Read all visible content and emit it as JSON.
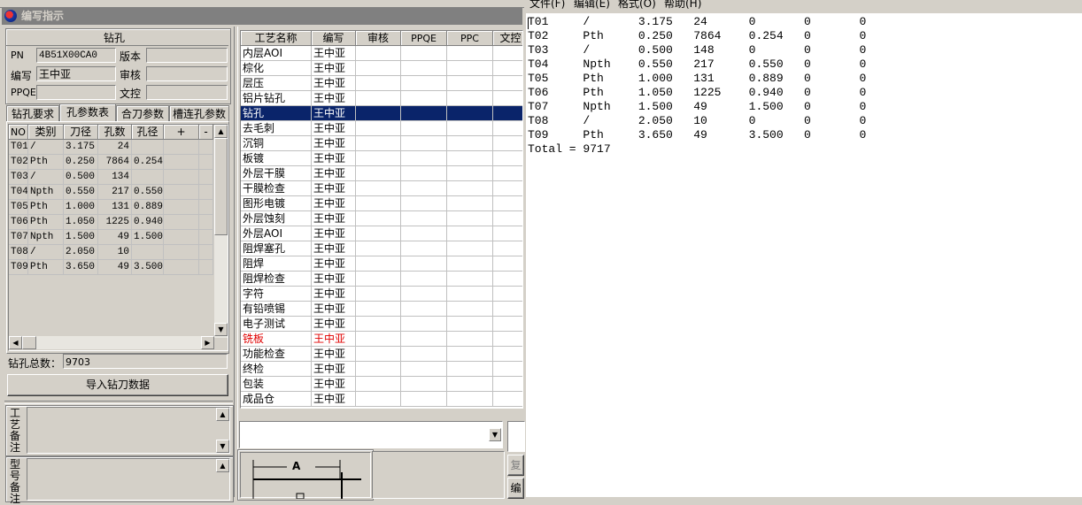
{
  "app": {
    "title": "编写指示"
  },
  "drill": {
    "section_title": "钻孔",
    "pn_label": "PN",
    "pn_value": "4B51X00CA0",
    "version_label": "版本",
    "version_value": "",
    "author_label": "编写",
    "author_value": "王中亚",
    "review_label": "审核",
    "review_value": "",
    "ppqe_label": "PPQE",
    "ppqe_value": "",
    "doc_label": "文控",
    "doc_value": ""
  },
  "tabs": [
    {
      "label": "钻孔要求"
    },
    {
      "label": "孔参数表"
    },
    {
      "label": "合刀参数"
    },
    {
      "label": "槽连孔参数"
    }
  ],
  "hole_table": {
    "headers": [
      "NO",
      "类别",
      "刀径",
      "孔数",
      "孔径",
      "+",
      "-"
    ],
    "rows": [
      [
        "T01",
        "/",
        "3.175",
        "24",
        ""
      ],
      [
        "T02",
        "Pth",
        "0.250",
        "7864",
        "0.254"
      ],
      [
        "T03",
        "/",
        "0.500",
        "134",
        ""
      ],
      [
        "T04",
        "Npth",
        "0.550",
        "217",
        "0.550"
      ],
      [
        "T05",
        "Pth",
        "1.000",
        "131",
        "0.889"
      ],
      [
        "T06",
        "Pth",
        "1.050",
        "1225",
        "0.940"
      ],
      [
        "T07",
        "Npth",
        "1.500",
        "49",
        "1.500"
      ],
      [
        "T08",
        "/",
        "2.050",
        "10",
        ""
      ],
      [
        "T09",
        "Pth",
        "3.650",
        "49",
        "3.500"
      ]
    ]
  },
  "total": {
    "label": "钻孔总数：",
    "value": "9703"
  },
  "import_button": "导入钻刀数据",
  "memo1_label": "工艺备注",
  "memo2_label": "型号备注",
  "process_table": {
    "headers": [
      "工艺名称",
      "编写",
      "审核",
      "PPQE",
      "PPC",
      "文控"
    ],
    "rows": [
      {
        "name": "内层AOI",
        "author": "王中亚",
        "state": "normal"
      },
      {
        "name": "棕化",
        "author": "王中亚",
        "state": "normal"
      },
      {
        "name": "层压",
        "author": "王中亚",
        "state": "normal"
      },
      {
        "name": "铝片钻孔",
        "author": "王中亚",
        "state": "normal"
      },
      {
        "name": "钻孔",
        "author": "王中亚",
        "state": "selected"
      },
      {
        "name": "去毛刺",
        "author": "王中亚",
        "state": "normal"
      },
      {
        "name": "沉铜",
        "author": "王中亚",
        "state": "normal"
      },
      {
        "name": "板镀",
        "author": "王中亚",
        "state": "normal"
      },
      {
        "name": "外层干膜",
        "author": "王中亚",
        "state": "normal"
      },
      {
        "name": "干膜检查",
        "author": "王中亚",
        "state": "normal"
      },
      {
        "name": "图形电镀",
        "author": "王中亚",
        "state": "normal"
      },
      {
        "name": "外层蚀刻",
        "author": "王中亚",
        "state": "normal"
      },
      {
        "name": "外层AOI",
        "author": "王中亚",
        "state": "normal"
      },
      {
        "name": "阻焊塞孔",
        "author": "王中亚",
        "state": "normal"
      },
      {
        "name": "阻焊",
        "author": "王中亚",
        "state": "normal"
      },
      {
        "name": "阻焊检查",
        "author": "王中亚",
        "state": "normal"
      },
      {
        "name": "字符",
        "author": "王中亚",
        "state": "normal"
      },
      {
        "name": "有铅喷锡",
        "author": "王中亚",
        "state": "normal"
      },
      {
        "name": "电子测试",
        "author": "王中亚",
        "state": "normal"
      },
      {
        "name": "铣板",
        "author": "王中亚",
        "state": "red"
      },
      {
        "name": "功能检查",
        "author": "王中亚",
        "state": "normal"
      },
      {
        "name": "终检",
        "author": "王中亚",
        "state": "normal"
      },
      {
        "name": "包装",
        "author": "王中亚",
        "state": "normal"
      },
      {
        "name": "成品仓",
        "author": "王中亚",
        "state": "normal"
      }
    ]
  },
  "diagram_label": "A",
  "side_buttons": [
    "复",
    "编"
  ],
  "notepad": {
    "menu": [
      "文件(F)",
      "编辑(E)",
      "格式(O)",
      "帮助(H)"
    ],
    "lines": [
      "T01     /       3.175   24      0       0       0",
      "T02     Pth     0.250   7864    0.254   0       0",
      "T03     /       0.500   148     0       0       0",
      "T04     Npth    0.550   217     0.550   0       0",
      "T05     Pth     1.000   131     0.889   0       0",
      "T06     Pth     1.050   1225    0.940   0       0",
      "T07     Npth    1.500   49      1.500   0       0",
      "T08     /       2.050   10      0       0       0",
      "T09     Pth     3.650   49      3.500   0       0",
      "Total = 9717"
    ]
  },
  "colors": {
    "face": "#d4d0c8",
    "selection": "#0a246a",
    "red_text": "#e00000",
    "title_inactive": "#808080"
  }
}
